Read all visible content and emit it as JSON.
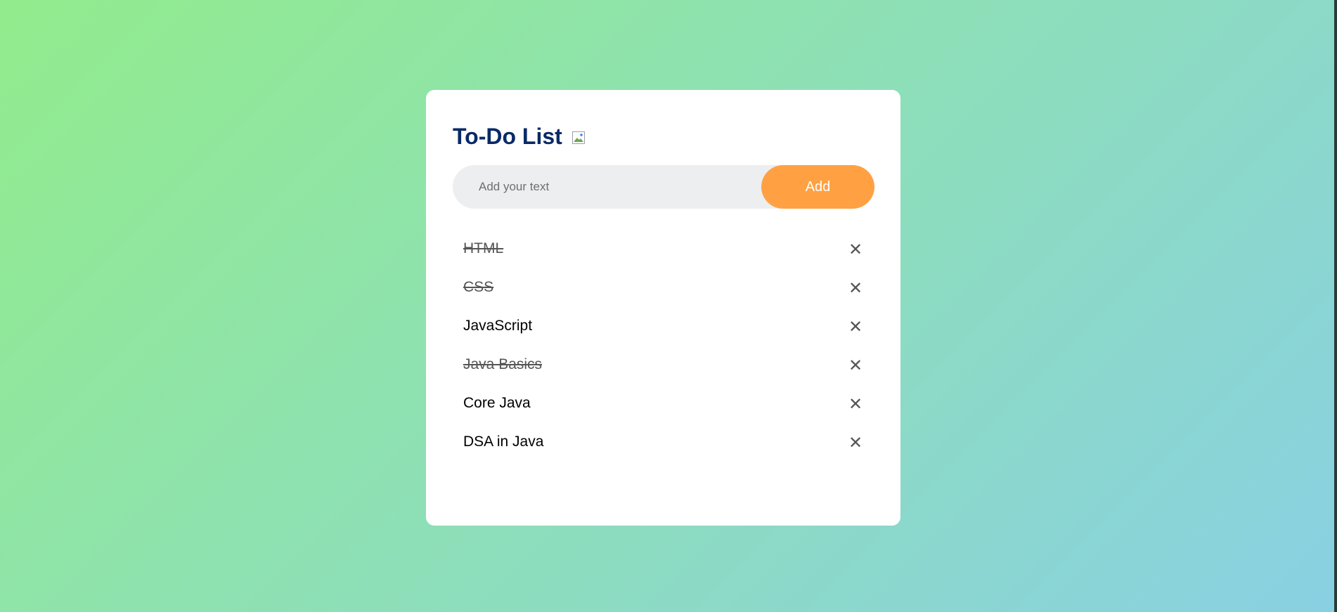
{
  "app": {
    "title": "To-Do List"
  },
  "input": {
    "placeholder": "Add your text",
    "value": ""
  },
  "add_button": {
    "label": "Add"
  },
  "tasks": [
    {
      "text": "HTML",
      "checked": true,
      "remove": "✕"
    },
    {
      "text": "CSS",
      "checked": true,
      "remove": "✕"
    },
    {
      "text": "JavaScript",
      "checked": false,
      "remove": "✕"
    },
    {
      "text": "Java Basics",
      "checked": true,
      "remove": "✕"
    },
    {
      "text": "Core Java",
      "checked": false,
      "remove": "✕"
    },
    {
      "text": "DSA in Java",
      "checked": false,
      "remove": "✕"
    }
  ],
  "colors": {
    "title": "#0a2a66",
    "accent": "#ffa143",
    "input_bg": "#edeef0"
  }
}
